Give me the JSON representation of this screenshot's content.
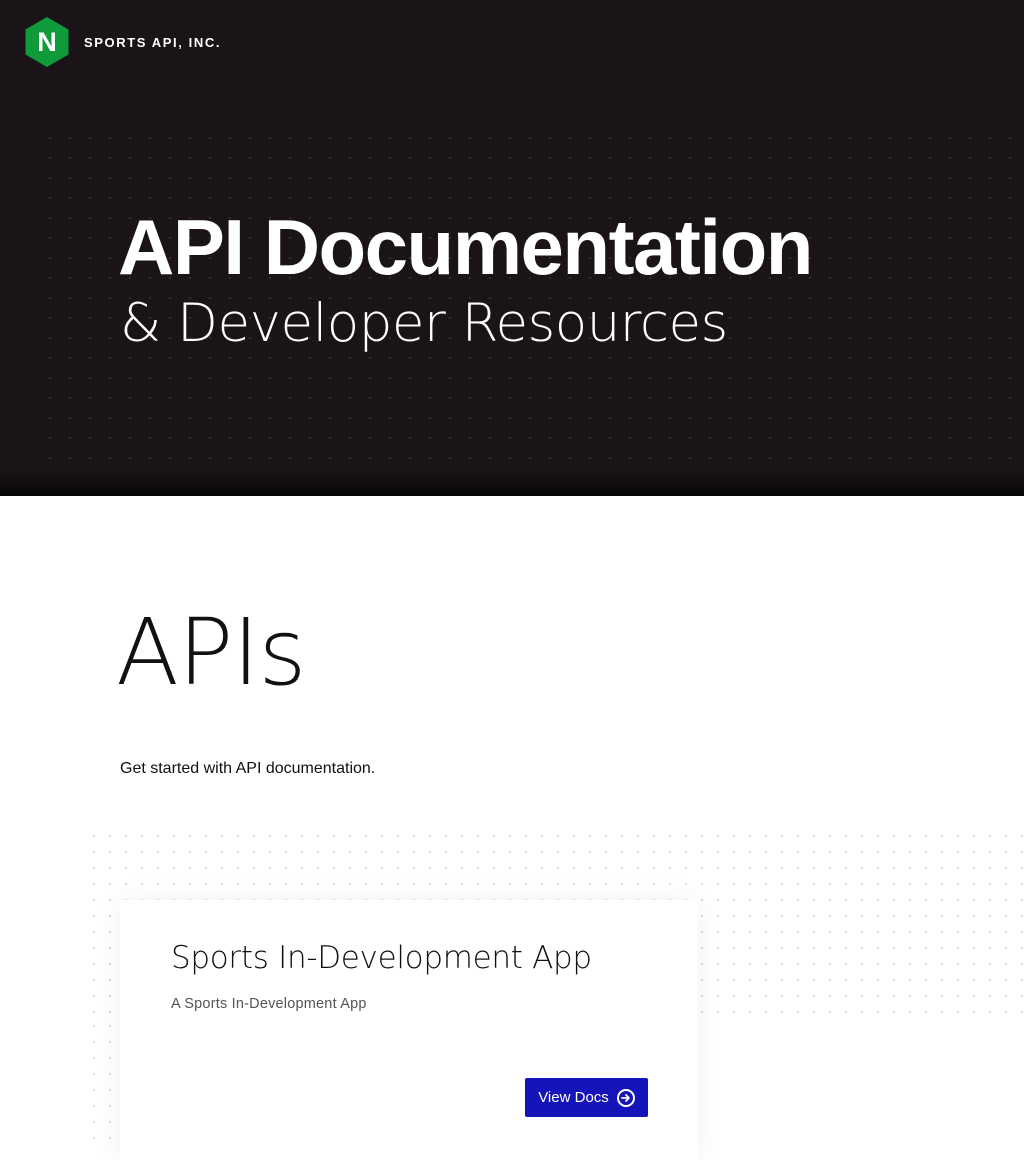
{
  "header": {
    "brand_name": "SPORTS API, INC.",
    "logo_letter": "N",
    "logo_color": "#0f9b3a",
    "background_color": "#1a1418"
  },
  "hero": {
    "title": "API Documentation",
    "subtitle": "& Developer Resources"
  },
  "apis": {
    "heading": "APIs",
    "intro": "Get started with API documentation.",
    "cards": [
      {
        "title": "Sports In-Development App",
        "description": "A Sports In-Development App",
        "button_label": "View Docs",
        "button_icon": "arrow-circle-right-icon",
        "button_color": "#1414b8"
      }
    ]
  }
}
